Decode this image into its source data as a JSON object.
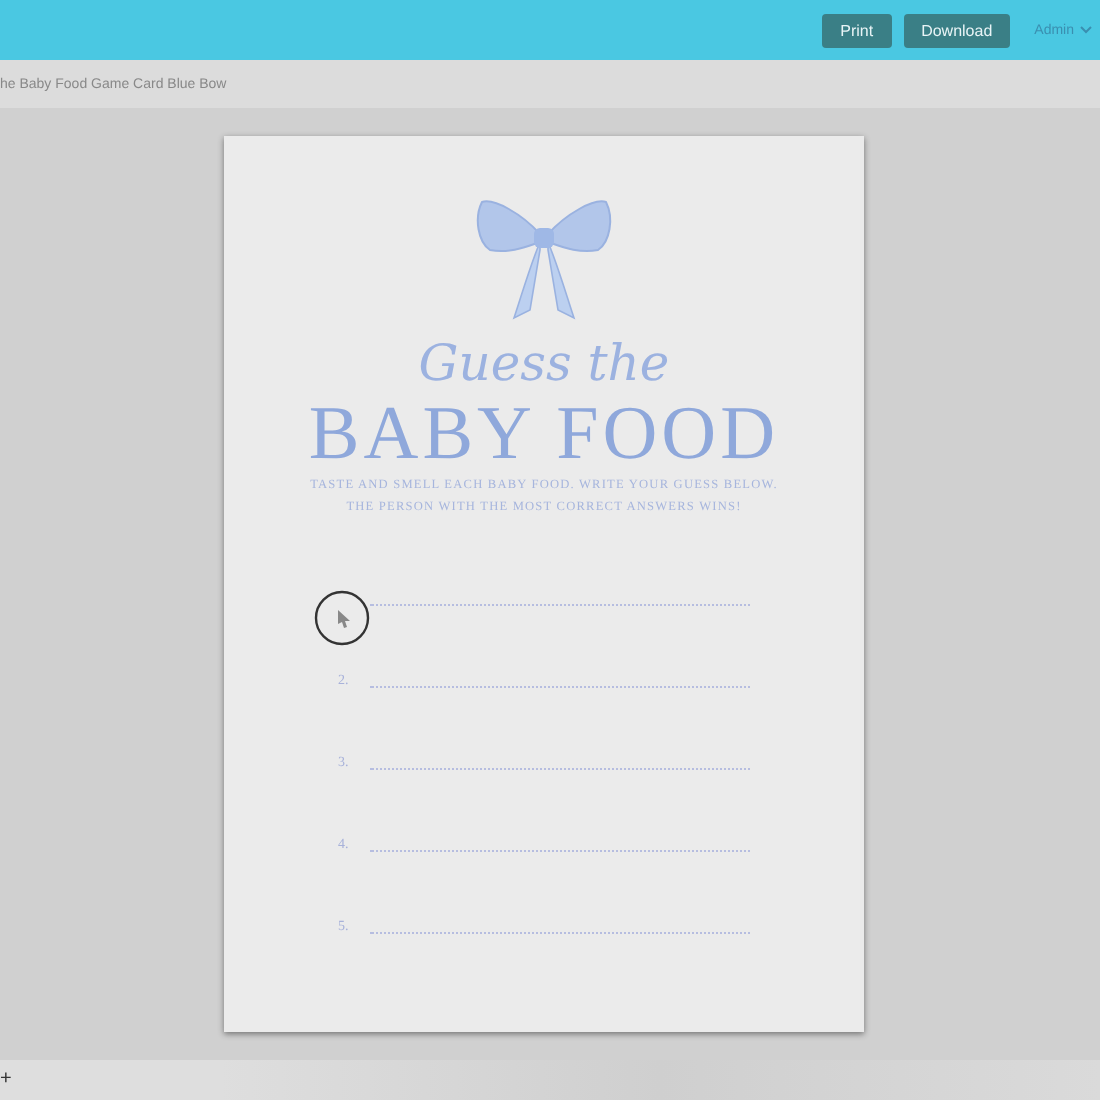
{
  "topbar": {
    "buttons": [
      "Print",
      "Download"
    ],
    "user_menu": "Admin"
  },
  "subheader": {
    "title": "he Baby Food Game Card Blue Bow"
  },
  "card": {
    "script_title": "Guess the",
    "title": "BABY FOOD",
    "instructions": [
      "TASTE AND SMELL EACH BABY FOOD. WRITE YOUR GUESS BELOW.",
      "THE PERSON WITH THE MOST CORRECT ANSWERS WINS!"
    ],
    "answer_lines": [
      {
        "kind": "cursor"
      },
      {
        "kind": "numbered",
        "number": "2."
      },
      {
        "kind": "numbered",
        "number": "3."
      },
      {
        "kind": "numbered",
        "number": "4."
      },
      {
        "kind": "numbered",
        "number": "5."
      }
    ]
  },
  "bottom_bar": {
    "button": "+"
  }
}
